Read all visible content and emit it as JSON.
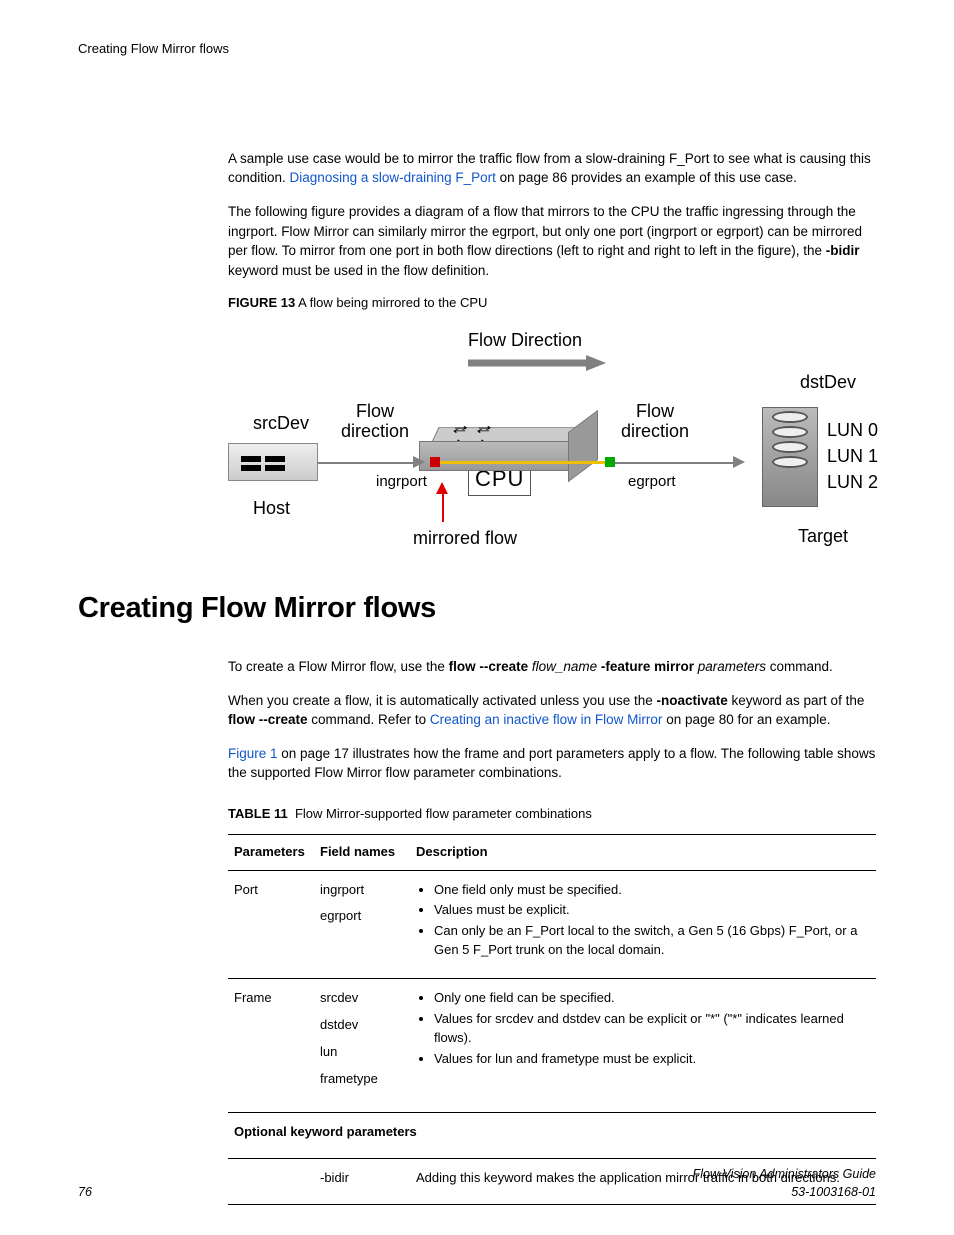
{
  "header": {
    "running_title": "Creating Flow Mirror flows"
  },
  "intro": {
    "p1_a": "A sample use case would be to mirror the traffic flow from a slow-draining F_Port to see what is causing this condition. ",
    "p1_link": "Diagnosing a slow-draining F_Port",
    "p1_b": " on page 86 provides an example of this use case.",
    "p2_a": "The following figure provides a diagram of a flow that mirrors to the CPU the traffic ingressing through the ingrport. Flow Mirror can similarly mirror the egrport, but only one port (ingrport or egrport) can be mirrored per flow. To mirror from one port in both flow directions (left to right and right to left in the figure), the ",
    "p2_bold": "-bidir",
    "p2_b": " keyword must be used in the flow definition."
  },
  "figure": {
    "number": "FIGURE 13",
    "caption": "A flow being mirrored to the CPU",
    "labels": {
      "flow_direction_title": "Flow Direction",
      "dstDev": "dstDev",
      "srcDev": "srcDev",
      "flow_direction": "Flow\ndirection",
      "lun0": "LUN 0",
      "lun1": "LUN 1",
      "lun2": "LUN 2",
      "host": "Host",
      "ingrport": "ingrport",
      "egrport": "egrport",
      "cpu": "CPU",
      "mirrored_flow": "mirrored flow",
      "target": "Target"
    }
  },
  "section": {
    "title": "Creating Flow Mirror flows"
  },
  "body": {
    "p1_a": "To create a Flow Mirror flow, use the ",
    "p1_b1": "flow --create",
    "p1_i1": " flow_name ",
    "p1_b2": "-feature mirror",
    "p1_i2": " parameters",
    "p1_c": " command.",
    "p2_a": "When you create a flow, it is automatically activated unless you use the ",
    "p2_b1": "-noactivate",
    "p2_b": " keyword as part of the ",
    "p2_b2": "flow --create",
    "p2_c": " command. Refer to ",
    "p2_link": "Creating an inactive flow in Flow Mirror",
    "p2_d": " on page 80 for an example.",
    "p3_link": "Figure 1",
    "p3_a": " on page 17 illustrates how the frame and port parameters apply to a flow. The following table shows the supported Flow Mirror flow parameter combinations."
  },
  "table": {
    "number": "TABLE 11",
    "caption": "Flow Mirror-supported flow parameter combinations",
    "headers": {
      "c1": "Parameters",
      "c2": "Field names",
      "c3": "Description"
    },
    "rows": [
      {
        "param": "Port",
        "fields": [
          "ingrport",
          "egrport"
        ],
        "desc": [
          "One field only must be specified.",
          "Values must be explicit.",
          "Can only be an F_Port local to the switch, a Gen 5 (16 Gbps) F_Port, or a Gen 5 F_Port trunk on the local domain."
        ]
      },
      {
        "param": "Frame",
        "fields": [
          "srcdev",
          "dstdev",
          "lun",
          "frametype"
        ],
        "desc": [
          "Only one field can be specified.",
          "Values for srcdev and dstdev can be explicit or \"*\" (\"*\" indicates learned flows).",
          "Values for lun and frametype must be explicit."
        ]
      }
    ],
    "subheader": "Optional keyword parameters",
    "optional": {
      "field": "-bidir",
      "desc": "Adding this keyword makes the application mirror traffic in both directions."
    }
  },
  "footer": {
    "page": "76",
    "doc_title": "Flow Vision Administrators Guide",
    "doc_number": "53-1003168-01"
  }
}
